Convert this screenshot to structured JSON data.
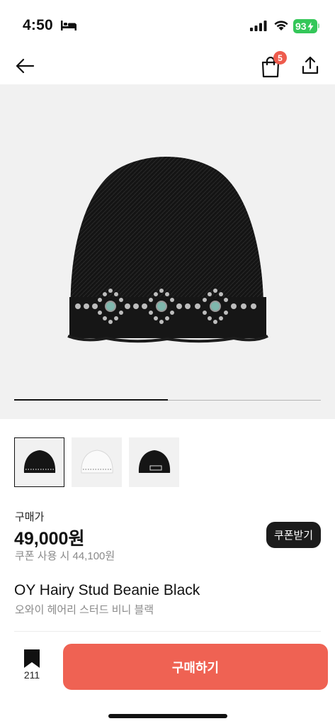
{
  "status_bar": {
    "time": "4:50",
    "battery": "93",
    "icons": [
      "bed-icon",
      "cellular-signal-icon",
      "wifi-icon",
      "battery-icon"
    ],
    "battery_color": "#34c759"
  },
  "nav": {
    "back_icon": "arrow-left-icon",
    "bag_icon": "shopping-bag-icon",
    "bag_count": "5",
    "share_icon": "share-icon",
    "badge_color": "#ee5b4d"
  },
  "gallery": {
    "progress": 0.5,
    "thumbnails": [
      {
        "name": "black-beanie",
        "selected": true
      },
      {
        "name": "white-beanie",
        "selected": false
      },
      {
        "name": "black-beanie-label",
        "selected": false
      }
    ]
  },
  "product": {
    "price_label": "구매가",
    "price": "49,000원",
    "coupon_price": "쿠폰 사용 시 44,100원",
    "coupon_button": "쿠폰받기",
    "name": "OY Hairy Stud Beanie Black",
    "name_ko": "오와이 헤어리 스터드 비니 블랙"
  },
  "bottom": {
    "bookmark_icon": "bookmark-icon",
    "bookmark_count": "211",
    "buy_button": "구매하기",
    "accent_color": "#ef6253"
  }
}
